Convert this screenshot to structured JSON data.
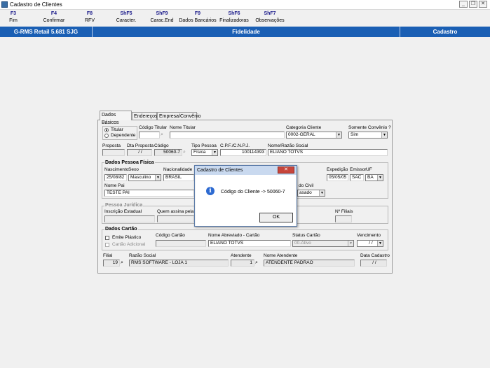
{
  "window": {
    "title": "Cadastro de Clientes",
    "controls": [
      "_",
      "❐",
      "✕"
    ]
  },
  "toolbar": [
    {
      "key": "F3",
      "label": "Fim"
    },
    {
      "key": "F4",
      "label": "Confirmar"
    },
    {
      "key": "F8",
      "label": "RFV"
    },
    {
      "key": "ShF5",
      "label": "Caracter."
    },
    {
      "key": "ShF9",
      "label": "Carac.End"
    },
    {
      "key": "F9",
      "label": "Dados Bancários"
    },
    {
      "key": "ShF6",
      "label": "Finalizadoras"
    },
    {
      "key": "ShF7",
      "label": "Observações"
    }
  ],
  "header": {
    "system": "G-RMS Retail 5.681 SJG",
    "module": "Fidelidade",
    "screen": "Cadastro"
  },
  "tabs": [
    "Dados Básicos",
    "Endereços",
    "Empresa/Convênio"
  ],
  "form": {
    "tipo_options": [
      "Titular",
      "Dependente"
    ],
    "tipo_selected": "Titular",
    "codigo_titular_label": "Código Titular",
    "nome_titular_label": "Nome Titular",
    "categoria_label": "Categoria Cliente",
    "categoria_value": "0002-GERAL",
    "somente_convenio_label": "Somente Convênio ?",
    "somente_convenio_value": "Sim",
    "proposta_label": "Proposta",
    "dta_proposta_label": "Dta Proposta",
    "dta_proposta_value": "/ /",
    "codigo_label": "Código",
    "codigo_value": "50060-7",
    "tipo_pessoa_label": "Tipo Pessoa",
    "tipo_pessoa_value": "Física",
    "cpf_label": "C.P.F./C.N.P.J.",
    "cpf_value": "100114393",
    "nome_razao_label": "Nome/Razão Social",
    "nome_razao_value": "ELIANO TOTVS",
    "pf_section": "Dados Pessoa Física",
    "nascimento_label": "Nascimento",
    "nascimento_value": "25/08/82",
    "sexo_label": "Sexo",
    "sexo_value": "Masculino",
    "nacionalidade_label": "Nacionalidade",
    "nacionalidade_value": "BRASIL",
    "expedicao_label": "Expedição",
    "expedicao_value": "05/05/05",
    "emissor_label": "Emissor",
    "emissor_value": "SAC",
    "uf_label": "UF",
    "uf_value": "BA",
    "nome_pai_label": "Nome Pai",
    "nome_pai_value": "TESTE PAI",
    "estado_civil_label": "do Civil",
    "estado_civil_value": "asado",
    "pj_section": "Pessoa Jurídica",
    "inscricao_label": "Inscrição Estadual",
    "quem_assina_label": "Quem assina pela E",
    "num_filiais_label": "Nº Filiais",
    "cartao_section": "Dados Cartão",
    "emite_plastico_label": "Emite Plástico",
    "cartao_adicional_label": "Cartão Adicional",
    "codigo_cartao_label": "Código Cartão",
    "nome_abreviado_label": "Nome Abreviado - Cartão",
    "nome_abreviado_value": "ELIANO TOTVS",
    "status_cartao_label": "Status Cartão",
    "status_cartao_value": "00-Ativo",
    "vencimento_label": "Vencimento",
    "vencimento_value": "/ /",
    "filial_label": "Filial",
    "filial_value": "19",
    "razao_social_label": "Razão Social",
    "razao_social_value": "RMS SOFTWARE - LOJA 1",
    "atendente_label": "Atendente",
    "atendente_value": "1",
    "nome_atendente_label": "Nome Atendente",
    "nome_atendente_value": "ATENDENTE PADRAO",
    "data_cadastro_label": "Data Cadastro",
    "data_cadastro_value": "/ /"
  },
  "dialog": {
    "title": "Cadastro de Clientes",
    "close": "✕",
    "message": "Código do Cliente -> 50060-7",
    "ok": "OK",
    "icon": "information-icon"
  },
  "colors": {
    "header_blue": "#1a5fb4",
    "toolbar_key": "#1a1a8a",
    "dialog_title": "#c9d9ef",
    "close_red": "#c7453b"
  }
}
